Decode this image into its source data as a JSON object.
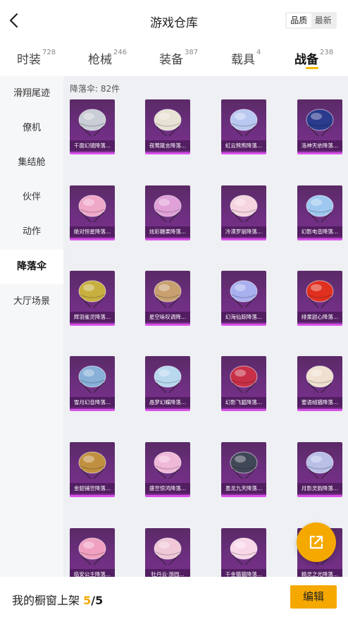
{
  "header": {
    "title": "游戏仓库",
    "sort_options": [
      "品质",
      "最新"
    ],
    "sort_selected": "品质"
  },
  "tabs": [
    {
      "label": "时装",
      "count": "728"
    },
    {
      "label": "枪械",
      "count": "246"
    },
    {
      "label": "装备",
      "count": "387"
    },
    {
      "label": "载具",
      "count": "4"
    },
    {
      "label": "战备",
      "count": "238",
      "active": true
    }
  ],
  "sidebar": {
    "items": [
      {
        "label": "滑翔尾迹"
      },
      {
        "label": "僚机"
      },
      {
        "label": "集结舱"
      },
      {
        "label": "伙伴"
      },
      {
        "label": "动作"
      },
      {
        "label": "降落伞",
        "active": true
      },
      {
        "label": "大厅场景"
      }
    ]
  },
  "content": {
    "count_label": "降落伞: 82件",
    "items": [
      {
        "name": "千面幻镜降落...",
        "icon": "silver-parachute",
        "color": "#c9cdd6"
      },
      {
        "name": "夜莺箴言降落...",
        "icon": "fan-parachute",
        "color": "#e8e2d4"
      },
      {
        "name": "虹云熊熊降落...",
        "icon": "rainbow-bear-parachute",
        "color": "#b9c8f0"
      },
      {
        "name": "洛神天依降落...",
        "icon": "blue-parachute",
        "color": "#2a3a8c"
      },
      {
        "name": "绝对恒星降落...",
        "icon": "pink-parachute",
        "color": "#f0a8c8"
      },
      {
        "name": "炫彩糖果降落...",
        "icon": "candy-wing-parachute",
        "color": "#e0a0d8"
      },
      {
        "name": "冷漠罗丽降落...",
        "icon": "ribbon-parachute",
        "color": "#f5d4e0"
      },
      {
        "name": "幻影电音降落...",
        "icon": "music-parachute",
        "color": "#9fc8f0"
      },
      {
        "name": "辉羽雀灵降落...",
        "icon": "feather-parachute",
        "color": "#c8b040"
      },
      {
        "name": "星空咏叹调降...",
        "icon": "golden-parachute",
        "color": "#c8a070"
      },
      {
        "name": "幻海仙踪降落...",
        "icon": "sea-parachute",
        "color": "#a8b0f0"
      },
      {
        "name": "绯果甜心降落...",
        "icon": "apple-parachute",
        "color": "#e03020"
      },
      {
        "name": "雪月幻音降落...",
        "icon": "snow-parachute",
        "color": "#88b0d8"
      },
      {
        "name": "晶梦幻蝶降落...",
        "icon": "butterfly-parachute",
        "color": "#b8d8f0"
      },
      {
        "name": "幻影飞狐降落...",
        "icon": "fox-parachute",
        "color": "#c83048"
      },
      {
        "name": "蜜语绒猫降落...",
        "icon": "cat-parachute",
        "color": "#f0e0d0"
      },
      {
        "name": "金貂铺世降落...",
        "icon": "gold-parachute",
        "color": "#c09040"
      },
      {
        "name": "盛世惊鸿降落...",
        "icon": "lantern-parachute",
        "color": "#f0b8d8"
      },
      {
        "name": "墨龙九天降落...",
        "icon": "dragon-parachute",
        "color": "#404858"
      },
      {
        "name": "月影灵韵降落...",
        "icon": "moon-parachute",
        "color": "#b8c0e8"
      },
      {
        "name": "临安公主降落...",
        "icon": "princess-parachute",
        "color": "#f0a0c0"
      },
      {
        "name": "牡丹云·游园...",
        "icon": "peony-parachute",
        "color": "#f0c8d8"
      },
      {
        "name": "千金猫猫降落...",
        "icon": "kitty-parachute",
        "color": "#f8d8e8"
      },
      {
        "name": "精灵之光降落...",
        "icon": "elf-parachute",
        "color": "#c0d0f0"
      }
    ]
  },
  "bottom": {
    "label": "我的橱窗上架",
    "current": "5",
    "separator": "/",
    "total": "5",
    "edit_label": "编辑"
  },
  "colors": {
    "accent": "#f5a800",
    "card_bg": "#6d2f80",
    "card_border": "#d84fe8"
  }
}
